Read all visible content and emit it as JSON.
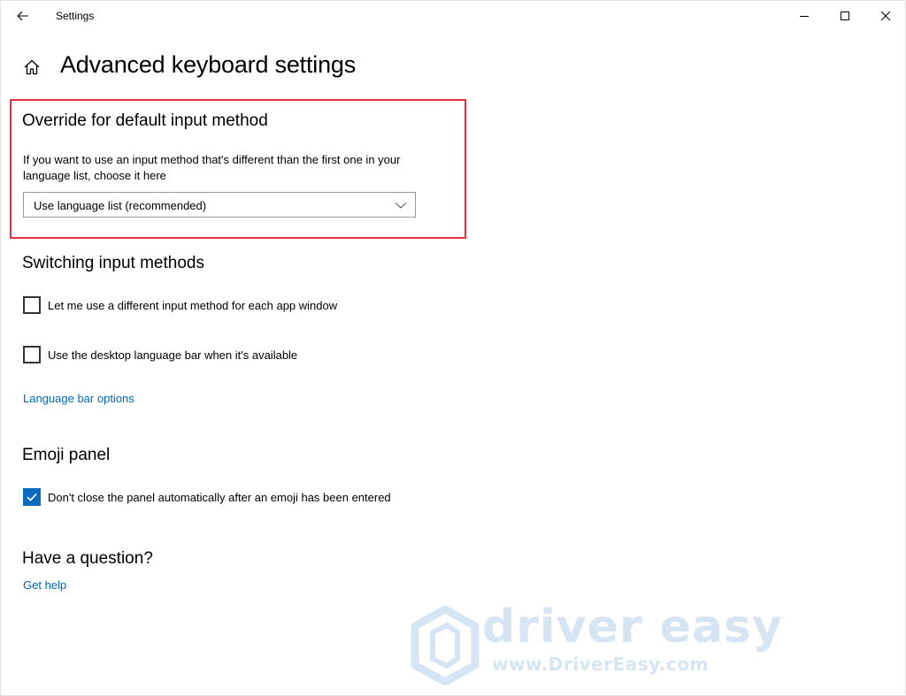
{
  "window": {
    "title": "Settings"
  },
  "page": {
    "title": "Advanced keyboard settings"
  },
  "override": {
    "heading": "Override for default input method",
    "description": "If you want to use an input method that's different than the first one in your language list, choose it here",
    "dropdown_value": "Use language list (recommended)"
  },
  "switching": {
    "heading": "Switching input methods",
    "checkboxes": [
      {
        "label": "Let me use a different input method for each app window",
        "checked": false
      },
      {
        "label": "Use the desktop language bar when it's available",
        "checked": false
      }
    ],
    "link": "Language bar options"
  },
  "emoji": {
    "heading": "Emoji panel",
    "checkbox": {
      "label": "Don't close the panel automatically after an emoji has been entered",
      "checked": true
    }
  },
  "help": {
    "heading": "Have a question?",
    "link": "Get help"
  },
  "watermark": {
    "brand": "driver easy",
    "url": "www.DriverEasy.com"
  },
  "colors": {
    "highlight_border": "#e5303d",
    "link": "#0067b8",
    "checkbox_checked": "#0b6cbd"
  },
  "icons": {
    "back": "arrow-left-icon",
    "home": "home-icon",
    "minimize": "minimize-icon",
    "maximize": "maximize-icon",
    "close": "close-icon",
    "chevron": "chevron-down-icon",
    "check": "checkmark-icon"
  }
}
